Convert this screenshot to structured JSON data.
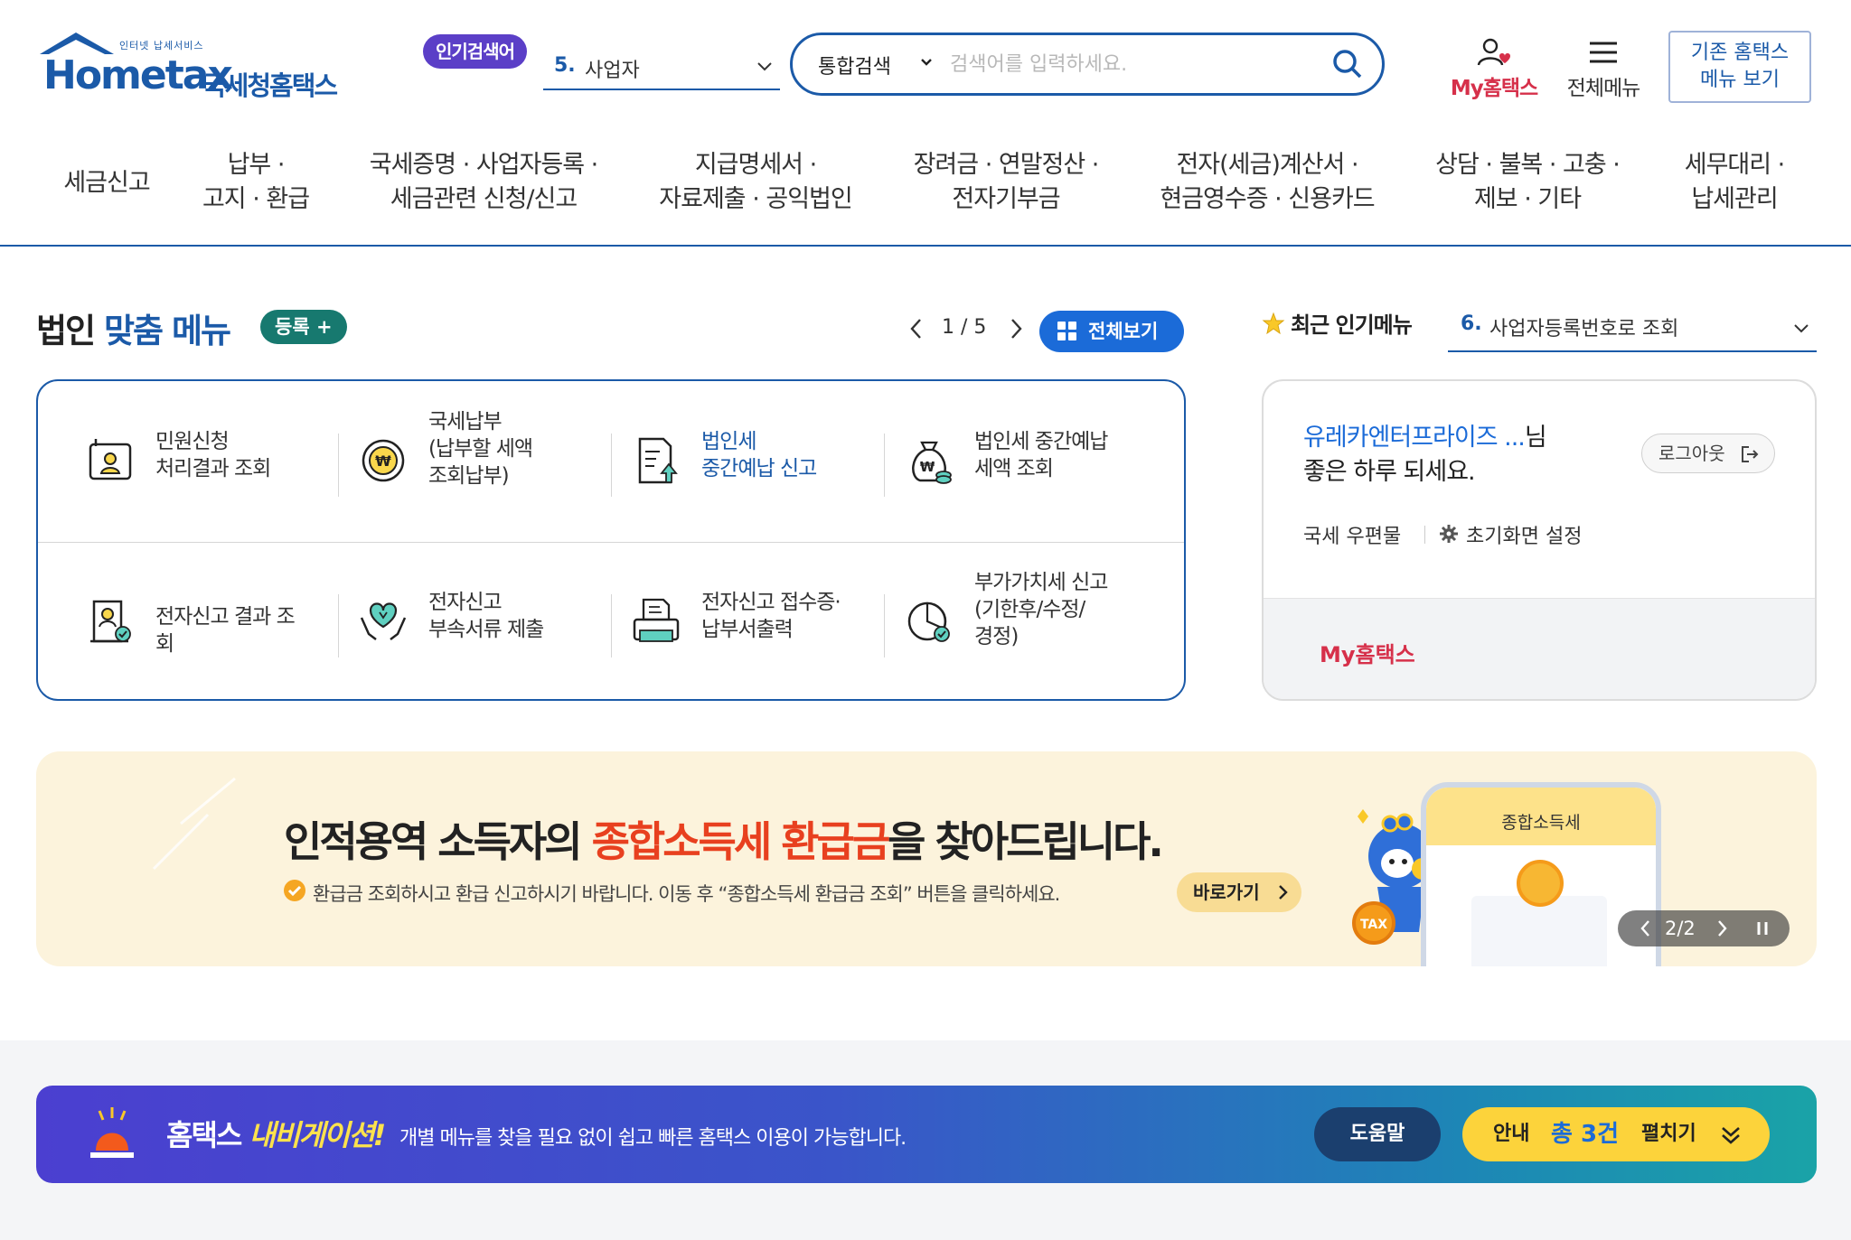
{
  "header": {
    "logo_tag": "인터넷 납세서비스",
    "logo_main": "Hometax",
    "logo_sub": "국세청홈택스",
    "popular_badge": "인기검색어",
    "popular_num": "5.",
    "popular_text": "사업자",
    "search_scope": "통합검색",
    "search_placeholder": "검색어를 입력하세요.",
    "my_hometax": "My홈택스",
    "all_menu": "전체메뉴",
    "old_menu_line1": "기존 홈택스",
    "old_menu_line2": "메뉴 보기"
  },
  "gnb": [
    "세금신고",
    "납부 ·\n고지 · 환급",
    "국세증명 · 사업자등록 ·\n세금관련 신청/신고",
    "지급명세서 ·\n자료제출 · 공익법인",
    "장려금 · 연말정산 ·\n전자기부금",
    "전자(세금)계산서 ·\n현금영수증 · 신용카드",
    "상담 · 불복 · 고충 ·\n제보 · 기타",
    "세무대리 ·\n납세관리"
  ],
  "custom_menu": {
    "title_plain": "법인",
    "title_accent": "맞춤 메뉴",
    "register": "등록 +",
    "pager": "1 / 5",
    "all_view": "전체보기",
    "items": [
      {
        "label": "민원신청\n처리결과 조회",
        "icon": "document-person-icon"
      },
      {
        "label": "국세납부\n(납부할 세액\n조회납부)",
        "icon": "won-coin-icon"
      },
      {
        "label": "법인세\n중간예납 신고",
        "icon": "document-upload-icon"
      },
      {
        "label": "법인세 중간예납\n세액 조회",
        "icon": "money-bag-icon"
      },
      {
        "label": "전자신고 결과 조회",
        "icon": "result-check-icon"
      },
      {
        "label": "전자신고\n부속서류 제출",
        "icon": "hands-heart-icon"
      },
      {
        "label": "전자신고 접수증·\n납부서출력",
        "icon": "printer-icon"
      },
      {
        "label": "부가가치세 신고\n(기한후/수정/\n경정)",
        "icon": "pie-chart-icon"
      }
    ]
  },
  "recent": {
    "label": "최근 인기메뉴",
    "num": "6.",
    "text": "사업자등록번호로 조회"
  },
  "user": {
    "name": "유레카엔터프라이즈 ...",
    "suffix": "님",
    "greeting": "좋은 하루 되세요.",
    "logout": "로그아웃",
    "mail": "국세 우편물",
    "setting": "초기화면 설정",
    "my_link": "My홈택스"
  },
  "banner": {
    "title_a": "인적용역 소득자의 ",
    "title_hl": "종합소득세 환급금",
    "title_b": "을 찾아드립니다.",
    "desc": "환급금 조회하시고 환급 신고하시기 바랍니다. 이동 후 “종합소득세 환급금 조회” 버튼을 클릭하세요.",
    "go": "바로가기",
    "phone_label": "종합소득세",
    "counter": "2/2"
  },
  "navi": {
    "title_a": "홈택스 ",
    "title_hl": "내비게이션!",
    "desc": "개별 메뉴를 찾을 필요 없이 쉽고 빠른 홈택스 이용이 가능합니다.",
    "help": "도움말",
    "info_a": "안내",
    "info_b": "총 3건",
    "info_c": "펼치기"
  },
  "colors": {
    "brand_blue": "#1b5aa8",
    "accent_red": "#d6304a",
    "badge_purple": "#5b3fc7",
    "highlight_orange": "#e8401f",
    "button_yellow": "#fcd33b"
  }
}
